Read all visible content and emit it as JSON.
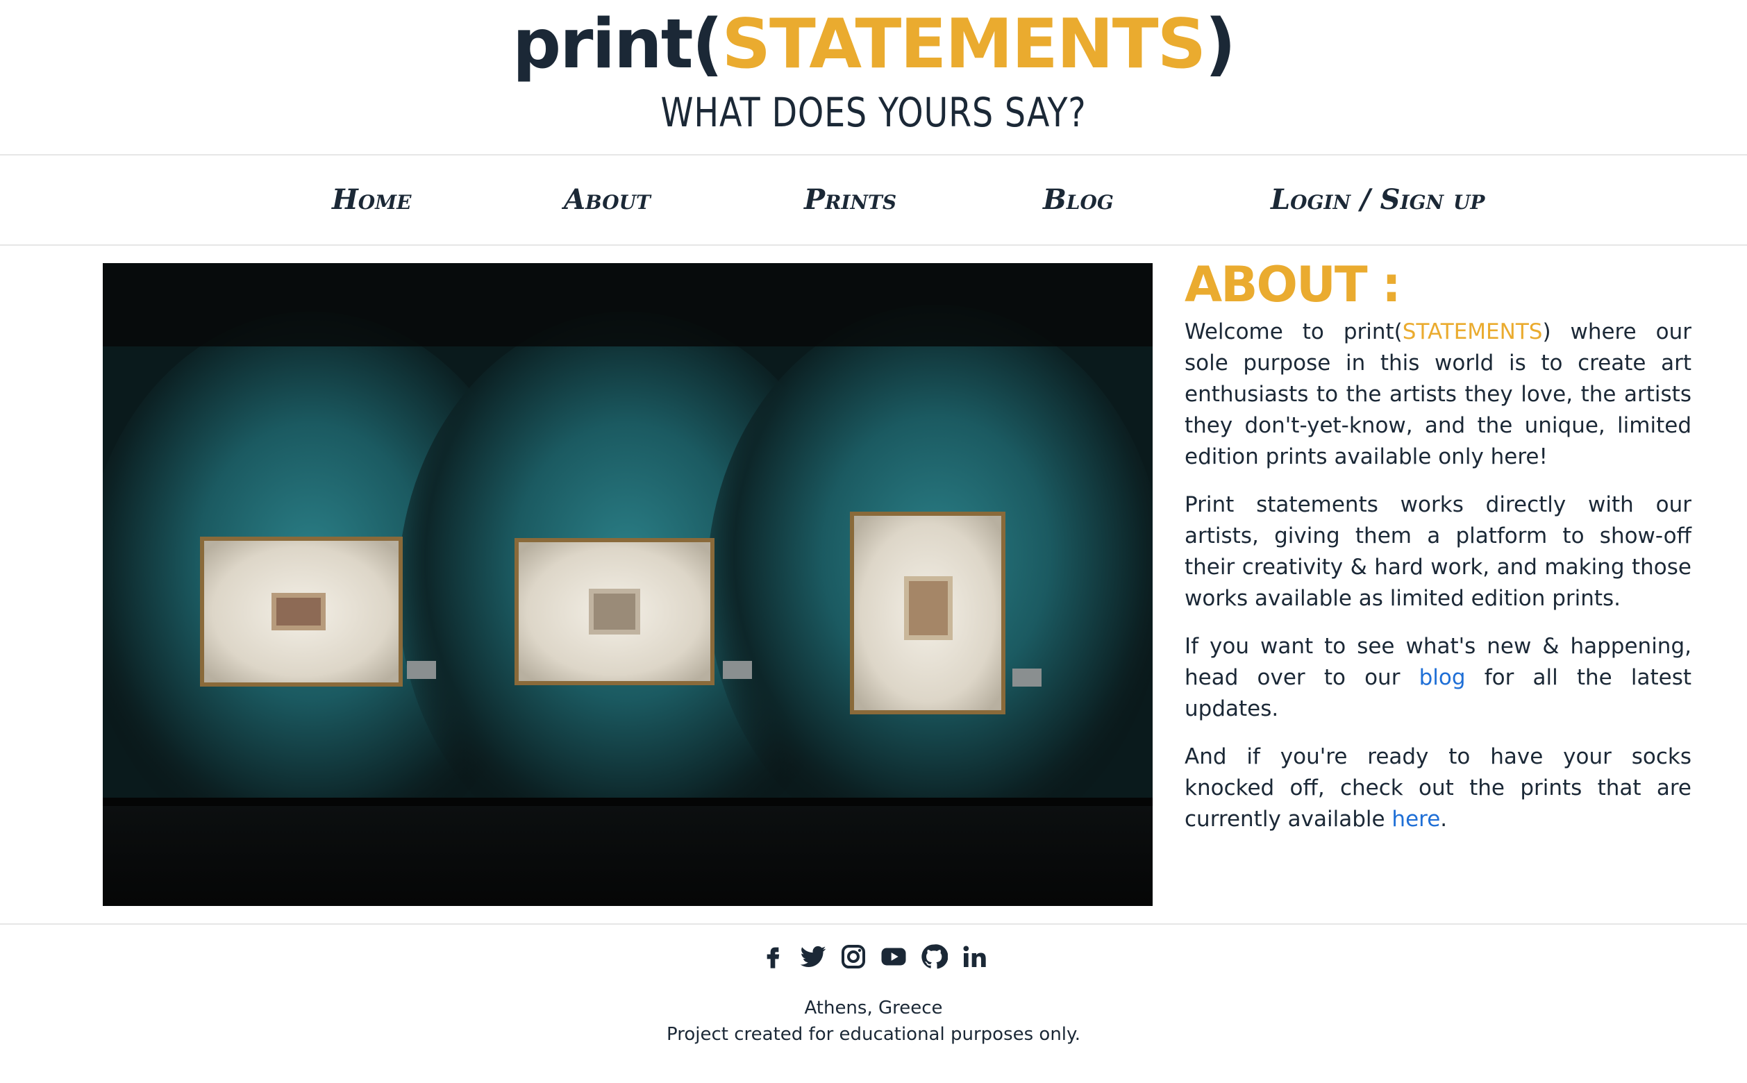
{
  "header": {
    "logo_prefix": "print(",
    "logo_accent": "STATEMENTS",
    "logo_suffix": ")",
    "tagline": "WHAT DOES YOURS SAY?"
  },
  "nav": {
    "home": "Home",
    "about": "About",
    "prints": "Prints",
    "blog": "Blog",
    "login": "Login / Sign up"
  },
  "about": {
    "title": "ABOUT :",
    "p1_a": "Welcome to print(",
    "p1_accent": "STATEMENTS",
    "p1_b": ") where our sole purpose in this world is to create art enthusiasts to the artists they love, the artists they don't-yet-know, and the unique, limited edition prints available only here!",
    "p2": "Print statements works directly with our artists, giving them a platform to show-off their creativity & hard work, and making those works available as limited edition prints.",
    "p3_a": "If you want to see what's new & happening, head over to our ",
    "p3_link": "blog",
    "p3_b": " for all the latest updates.",
    "p4_a": "And if you're ready to have your socks knocked off, check out the prints that are currently available ",
    "p4_link": "here",
    "p4_b": "."
  },
  "footer": {
    "location": "Athens, Greece",
    "note": "Project created for educational purposes only.",
    "socials": [
      "facebook-icon",
      "twitter-icon",
      "instagram-icon",
      "youtube-icon",
      "github-icon",
      "linkedin-icon"
    ]
  },
  "colors": {
    "accent": "#eaab2f",
    "navy": "#1b2836",
    "link": "#1f6fd6"
  }
}
